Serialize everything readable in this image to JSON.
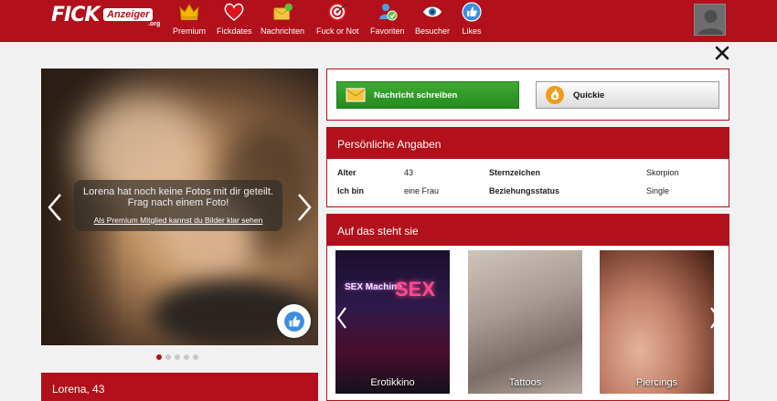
{
  "header": {
    "logo": {
      "main": "FICK",
      "badge": "Anzeiger",
      "suffix": ".org"
    },
    "nav": [
      {
        "id": "premium",
        "label": "Premium",
        "icon": "crown-icon"
      },
      {
        "id": "fickdates",
        "label": "Fickdates",
        "icon": "heart-icon"
      },
      {
        "id": "nachrichten",
        "label": "Nachrichten",
        "icon": "envelope-icon"
      },
      {
        "id": "fuckornot",
        "label": "Fuck or Not",
        "icon": "target-icon"
      },
      {
        "id": "favoriten",
        "label": "Favoriten",
        "icon": "user-star-icon"
      },
      {
        "id": "besucher",
        "label": "Besucher",
        "icon": "eye-icon"
      },
      {
        "id": "likes",
        "label": "Likes",
        "icon": "thumbs-up-icon"
      }
    ],
    "brand_color": "#b2101a"
  },
  "photo": {
    "message": "Lorena hat noch keine Fotos mit dir geteilt. Frag nach einem Foto!",
    "premium_link": "Als Premium Mitglied kannst du Bilder klar sehen",
    "dots_total": 5,
    "dots_active": 0
  },
  "profile_name": "Lorena, 43",
  "actions": {
    "message_button": "Nachricht schreiben",
    "quickie_button": "Quickie"
  },
  "personal": {
    "title": "Persönliche Angaben",
    "rows": [
      {
        "label1": "Alter",
        "value1": "43",
        "label2": "Sternzeichen",
        "value2": "Skorpion"
      },
      {
        "label1": "Ich bin",
        "value1": "eine Frau",
        "label2": "Beziehungsstatus",
        "value2": "Single"
      }
    ]
  },
  "likes": {
    "title": "Auf das steht sie",
    "tiles": [
      {
        "label": "Erotikkino",
        "sign1": "SEX Machine",
        "sign2": "SEX"
      },
      {
        "label": "Tattoos"
      },
      {
        "label": "Piercings"
      }
    ]
  }
}
